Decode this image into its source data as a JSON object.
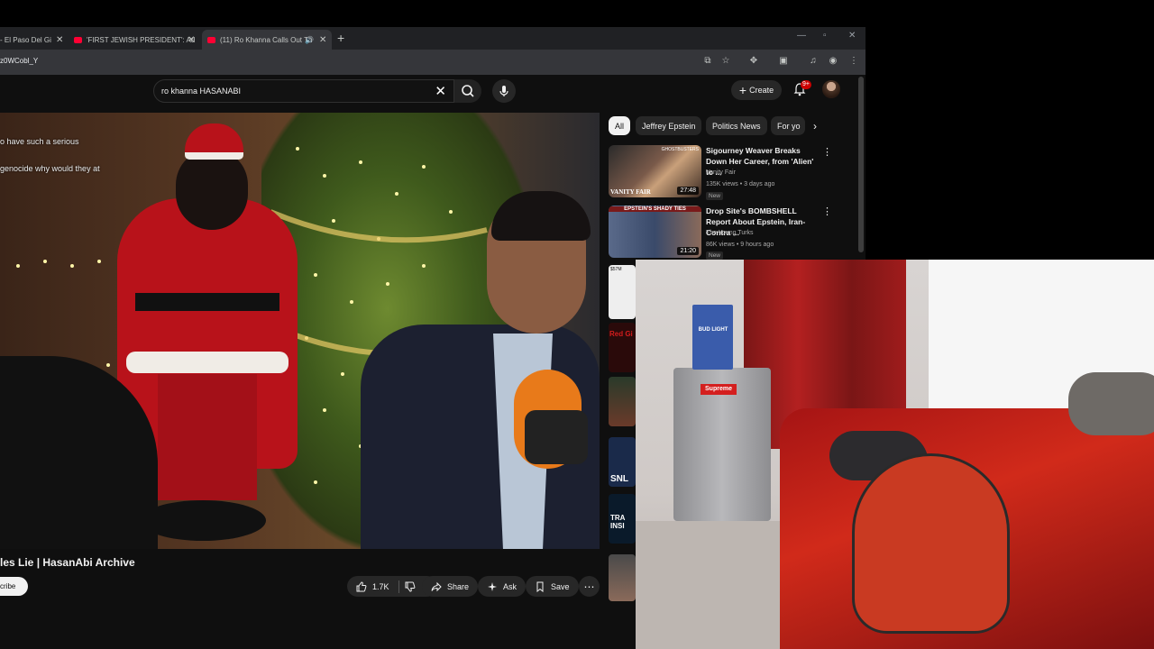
{
  "browser": {
    "tabs": [
      {
        "label": "- El Paso Del Gi"
      },
      {
        "label": "'FIRST JEWISH PRESIDENT': Ad"
      },
      {
        "label": "(11) Ro Khanna Calls Out Th"
      }
    ],
    "url": "z0WCobl_Y"
  },
  "search": {
    "query": "ro khanna HASANABI"
  },
  "masthead": {
    "create_label": "Create",
    "notification_count": "9+"
  },
  "player": {
    "chat_lines": [
      "o have such a serious",
      "genocide why would they at"
    ]
  },
  "video": {
    "title": "les Lie | HasanAbi Archive",
    "subscribe_label": "cribe",
    "like_count": "1.7K",
    "share_label": "Share",
    "ask_label": "Ask",
    "save_label": "Save"
  },
  "chips": [
    {
      "label": "All",
      "active": true
    },
    {
      "label": "Jeffrey Epstein",
      "active": false
    },
    {
      "label": "Politics News",
      "active": false
    },
    {
      "label": "For yo",
      "active": false
    }
  ],
  "recommendations": [
    {
      "title": "Sigourney Weaver Breaks Down Her Career, from 'Alien' to ...",
      "channel": "Vanity Fair",
      "meta": "135K views • 3 days ago",
      "badge": "New",
      "duration": "27:48",
      "thumb_top_text": "GHOSTBUSTERS",
      "thumb_bottom_text": "VANITY FAIR"
    },
    {
      "title": "Drop Site's BOMBSHELL Report About Epstein, Iran-Contra ...",
      "channel": "The Young Turks",
      "meta": "86K views • 9 hours ago",
      "badge": "New",
      "duration": "21:20",
      "thumb_top_text": "EPSTEIN'S SHADY TIES"
    }
  ],
  "mini_thumbs": [
    "$57M",
    "Red Gi",
    "",
    "SNL",
    "TRA INSI",
    ""
  ],
  "webcam": {
    "box_text": "BUD LIGHT",
    "sticker_text": "Supreme"
  },
  "colors": {
    "yt_red": "#ff0033",
    "bg": "#0f0f0f",
    "chip_bg": "#272727"
  }
}
